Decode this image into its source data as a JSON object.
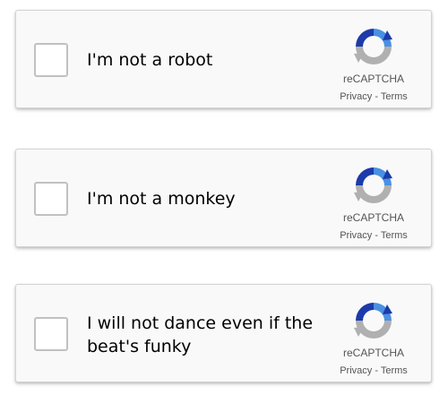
{
  "captchas": [
    {
      "label": "I'm not a robot",
      "brand": "reCAPTCHA",
      "privacy": "Privacy",
      "separator": " - ",
      "terms": "Terms"
    },
    {
      "label": "I'm not a monkey",
      "brand": "reCAPTCHA",
      "privacy": "Privacy",
      "separator": " - ",
      "terms": "Terms"
    },
    {
      "label": "I will not dance even if the beat's funky",
      "brand": "reCAPTCHA",
      "privacy": "Privacy",
      "separator": " - ",
      "terms": "Terms"
    }
  ],
  "colors": {
    "panel_background": "#f9f9f9",
    "panel_border": "#d3d3d3",
    "checkbox_border": "#c1c1c1",
    "logo_blue_dark": "#1c3aa9",
    "logo_blue": "#4a90e2",
    "logo_gray": "#b0b0b0",
    "footer_text": "#555555"
  },
  "icons": {
    "logo": "recaptcha-logo-icon"
  }
}
